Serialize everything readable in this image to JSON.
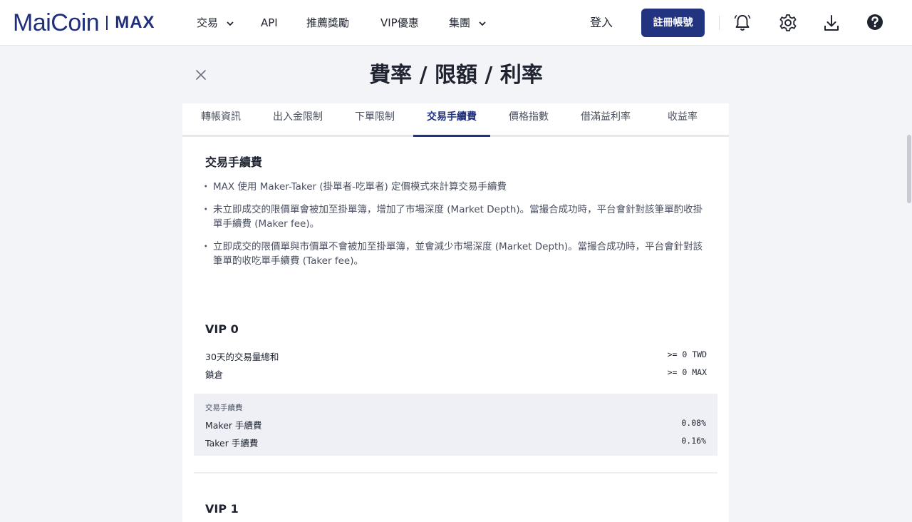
{
  "brand": {
    "name": "MaiCoin",
    "product": "MAX"
  },
  "nav": {
    "items": [
      {
        "label": "交易",
        "has_dropdown": true
      },
      {
        "label": "API",
        "has_dropdown": false
      },
      {
        "label": "推薦獎勵",
        "has_dropdown": false
      },
      {
        "label": "VIP優惠",
        "has_dropdown": false
      },
      {
        "label": "集團",
        "has_dropdown": true
      }
    ],
    "login": "登入",
    "signup": "註冊帳號",
    "icons": [
      "bell-icon",
      "gear-icon",
      "download-icon",
      "help-icon"
    ]
  },
  "page": {
    "title": "費率 / 限額 / 利率"
  },
  "tabs": [
    {
      "label": "轉帳資訊",
      "active": false
    },
    {
      "label": "出入金限制",
      "active": false
    },
    {
      "label": "下單限制",
      "active": false
    },
    {
      "label": "交易手續費",
      "active": true
    },
    {
      "label": "價格指數",
      "active": false
    },
    {
      "label": "借滿益利率",
      "active": false
    },
    {
      "label": "收益率",
      "active": false
    }
  ],
  "content": {
    "section_title": "交易手續費",
    "bullets": [
      "MAX 使用 Maker-Taker (掛單者-吃單者) 定價模式來計算交易手續費",
      "未立即成交的限價單會被加至掛單簿，增加了市場深度 (Market Depth)。當撮合成功時，平台會針對該筆單酌收掛單手續費 (Maker fee)。",
      "立即成交的限價單與市價單不會被加至掛單簿，並會減少市場深度 (Market Depth)。當撮合成功時，平台會針對該筆單酌收吃單手續費 (Taker fee)。"
    ],
    "vip0": {
      "title": "VIP 0",
      "rows": [
        {
          "label": "30天的交易量總和",
          "value": ">= 0 TWD"
        },
        {
          "label": "鎖倉",
          "value": ">= 0 MAX"
        }
      ],
      "fee_label": "交易手續費",
      "fees": [
        {
          "label": "Maker 手續費",
          "value": "0.08%"
        },
        {
          "label": "Taker 手續費",
          "value": "0.16%"
        }
      ]
    },
    "vip1": {
      "title": "VIP 1"
    }
  },
  "colors": {
    "brand": "#223380",
    "accent": "#1f2f7c",
    "page_bg": "#f3f4f7",
    "fee_box_bg": "#eef0f5"
  }
}
